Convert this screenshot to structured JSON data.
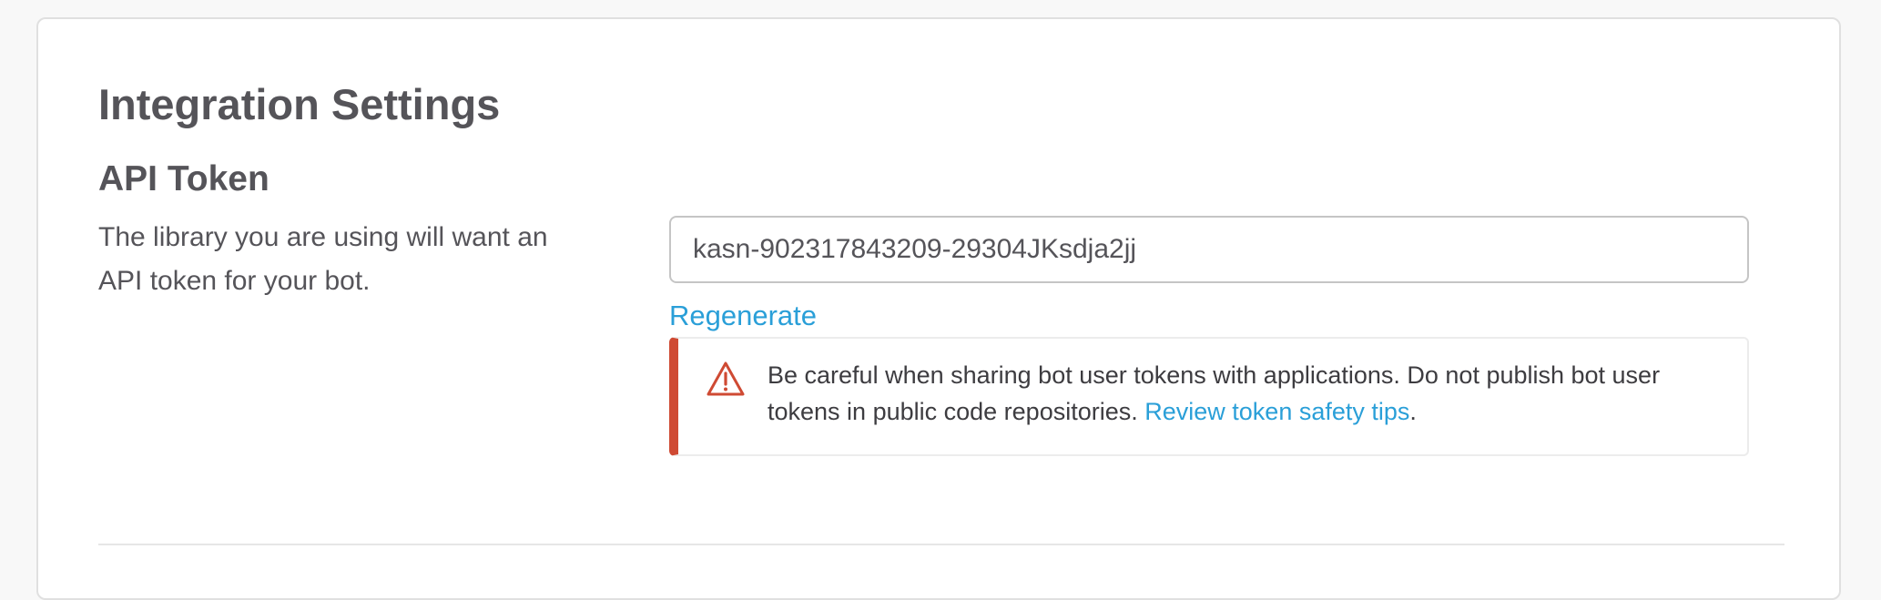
{
  "page": {
    "title": "Integration Settings"
  },
  "api_token": {
    "heading": "API Token",
    "description": "The library you are using will want an API token for your bot.",
    "token_value": "kasn-902317843209-29304JKsdja2jj",
    "regenerate_label": "Regenerate"
  },
  "warning": {
    "icon": "warning-triangle-icon",
    "text": "Be careful when sharing bot user tokens with applications. Do not publish bot user tokens in public code repositories.",
    "link_label": "Review token safety tips",
    "trailing": "."
  },
  "colors": {
    "accent_link": "#2a9fd8",
    "warning_border": "#cf4a33",
    "heading": "#555459"
  }
}
